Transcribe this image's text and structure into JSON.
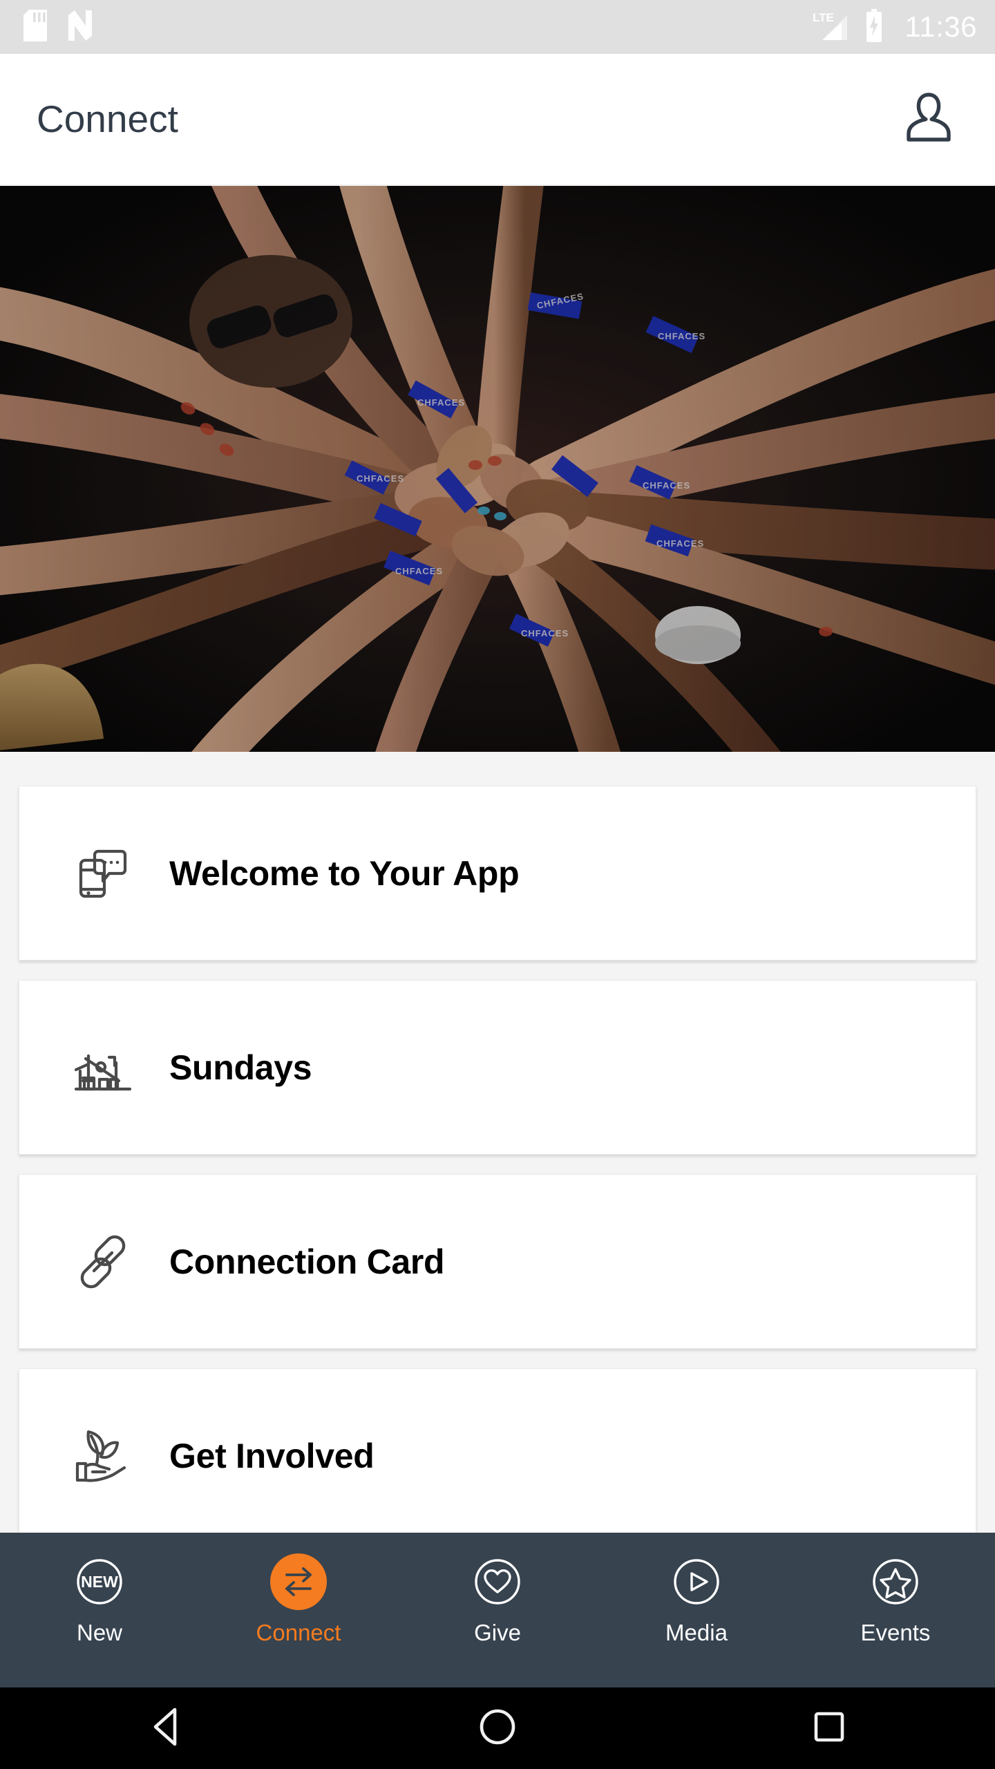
{
  "status_bar": {
    "icons": [
      "sd-card-icon",
      "nfc-icon"
    ],
    "network_label": "LTE",
    "signal_icon": "signal-bars-icon",
    "battery_icon": "battery-charging-icon",
    "time": "11:36",
    "background_color": "#e0e0e0",
    "foreground_color": "#ffffff"
  },
  "header": {
    "title": "Connect",
    "profile_icon": "person-icon",
    "title_color": "#333d49",
    "background_color": "#ffffff"
  },
  "hero": {
    "alt": "Overhead photo of many hands and arms reaching into a circle, wearing blue wristbands",
    "wristband_color": "#1a2ec2",
    "background_color": "#0d0a0b"
  },
  "cards": [
    {
      "label": "Welcome to Your App",
      "icon": "phone-chat-icon"
    },
    {
      "label": "Sundays",
      "icon": "church-building-icon"
    },
    {
      "label": "Connection Card",
      "icon": "chain-link-icon"
    },
    {
      "label": "Get Involved",
      "icon": "hand-plant-icon"
    }
  ],
  "tab_bar": {
    "background_color": "#37434f",
    "active_color": "#f57c20",
    "inactive_color": "#ffffff",
    "tabs": [
      {
        "label": "New",
        "icon": "new-badge-icon",
        "active": false
      },
      {
        "label": "Connect",
        "icon": "two-way-arrows-icon",
        "active": true
      },
      {
        "label": "Give",
        "icon": "heart-icon",
        "active": false
      },
      {
        "label": "Media",
        "icon": "play-icon",
        "active": false
      },
      {
        "label": "Events",
        "icon": "star-icon",
        "active": false
      }
    ],
    "new_badge_text": "NEW"
  },
  "android_nav": {
    "buttons": [
      "back-icon",
      "home-icon",
      "recents-icon"
    ],
    "background_color": "#000000",
    "icon_color": "#f1f1f1"
  }
}
